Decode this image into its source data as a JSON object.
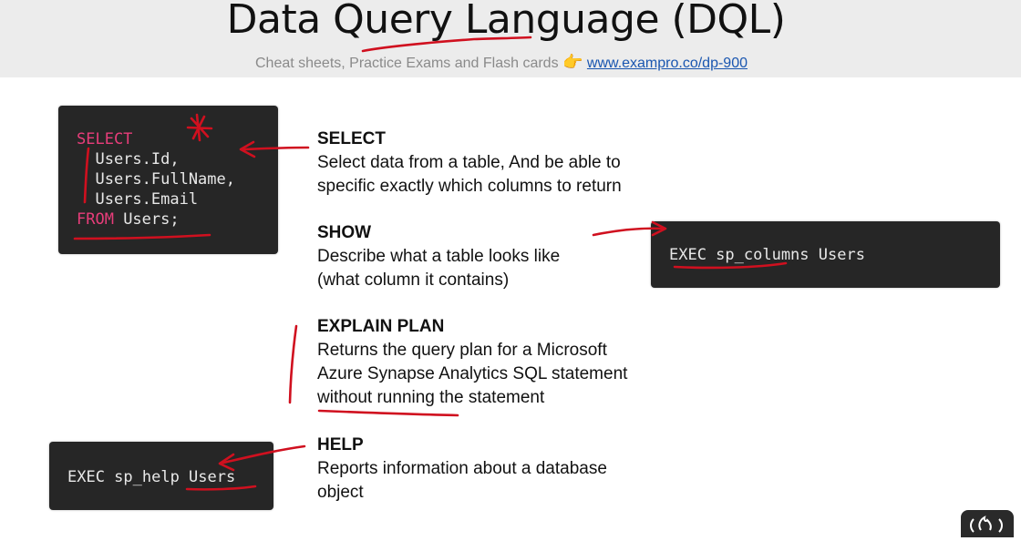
{
  "header": {
    "title": "Data Query Language (DQL)",
    "subtitle_text": "Cheat sheets, Practice Exams and Flash cards",
    "subtitle_emoji": "👉",
    "link_text": "www.exampro.co/dp-900"
  },
  "code_select": {
    "lines": [
      {
        "kw": "SELECT",
        "text": ""
      },
      {
        "kw": "",
        "text": "  Users.Id,"
      },
      {
        "kw": "",
        "text": "  Users.FullName,"
      },
      {
        "kw": "",
        "text": "  Users.Email"
      },
      {
        "kw": "FROM",
        "text": " Users;"
      }
    ]
  },
  "code_show": {
    "text": "EXEC sp_columns Users"
  },
  "code_help": {
    "text": "EXEC sp_help Users"
  },
  "terms": {
    "select": {
      "name": "SELECT",
      "desc1": "Select data from a table, And be able to",
      "desc2": "specific exactly which columns to return"
    },
    "show": {
      "name": "SHOW",
      "desc1": "Describe what a table looks like",
      "desc2": "(what column it contains)"
    },
    "explain": {
      "name": "EXPLAIN PLAN",
      "desc1": "Returns the query plan for a Microsoft",
      "desc2": "Azure Synapse Analytics SQL statement",
      "desc3": "without running the statement"
    },
    "help": {
      "name": "HELP",
      "desc1": "Reports information about a database",
      "desc2": "object"
    }
  },
  "colors": {
    "ink": "#d0101f",
    "keyword": "#e83d7a",
    "link": "#1a56b0",
    "code_bg": "#262626"
  },
  "icons": [
    "point-right-emoji",
    "freecodecamp-flame-icon"
  ]
}
